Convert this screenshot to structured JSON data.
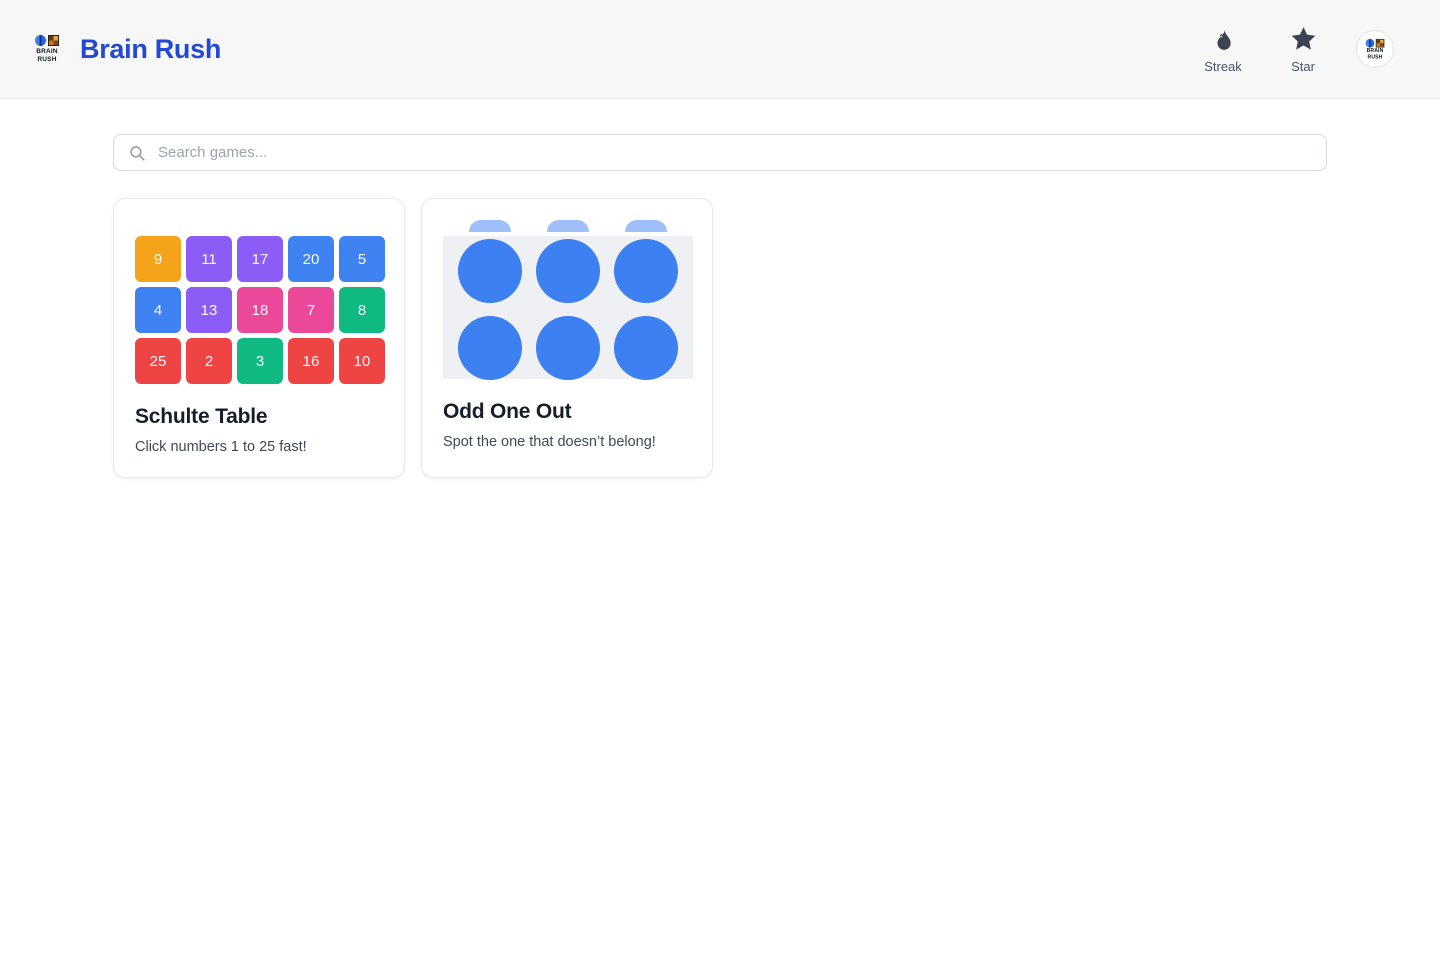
{
  "app": {
    "title": "Brain Rush",
    "logo_line1": "BRAIN",
    "logo_line2": "RUSH"
  },
  "header": {
    "streak_label": "Streak",
    "star_label": "Star"
  },
  "search": {
    "placeholder": "Search games...",
    "value": ""
  },
  "cards": {
    "schulte": {
      "title": "Schulte Table",
      "subtitle": "Click numbers 1 to 25 fast!",
      "tiles": [
        {
          "n": 9,
          "c": "amber"
        },
        {
          "n": 11,
          "c": "purple"
        },
        {
          "n": 17,
          "c": "purple"
        },
        {
          "n": 20,
          "c": "blue"
        },
        {
          "n": 5,
          "c": "blue"
        },
        {
          "n": 4,
          "c": "blue"
        },
        {
          "n": 13,
          "c": "purple"
        },
        {
          "n": 18,
          "c": "pink"
        },
        {
          "n": 7,
          "c": "pink"
        },
        {
          "n": 8,
          "c": "green"
        },
        {
          "n": 25,
          "c": "red"
        },
        {
          "n": 2,
          "c": "red"
        },
        {
          "n": 3,
          "c": "green"
        },
        {
          "n": 16,
          "c": "red"
        },
        {
          "n": 10,
          "c": "red"
        }
      ]
    },
    "odd_one_out": {
      "title": "Odd One Out",
      "subtitle": "Spot the one that doesn’t belong!",
      "circle_count": 6,
      "circle_color": "#3d80f2"
    }
  },
  "colors": {
    "brand_blue": "#2149d6",
    "icon_slate": "#3c4454",
    "tile_amber": "#f5a31b",
    "tile_purple": "#8b5cf6",
    "tile_blue": "#3f82f2",
    "tile_pink": "#ec4899",
    "tile_green": "#10b981",
    "tile_red": "#ef4444"
  }
}
